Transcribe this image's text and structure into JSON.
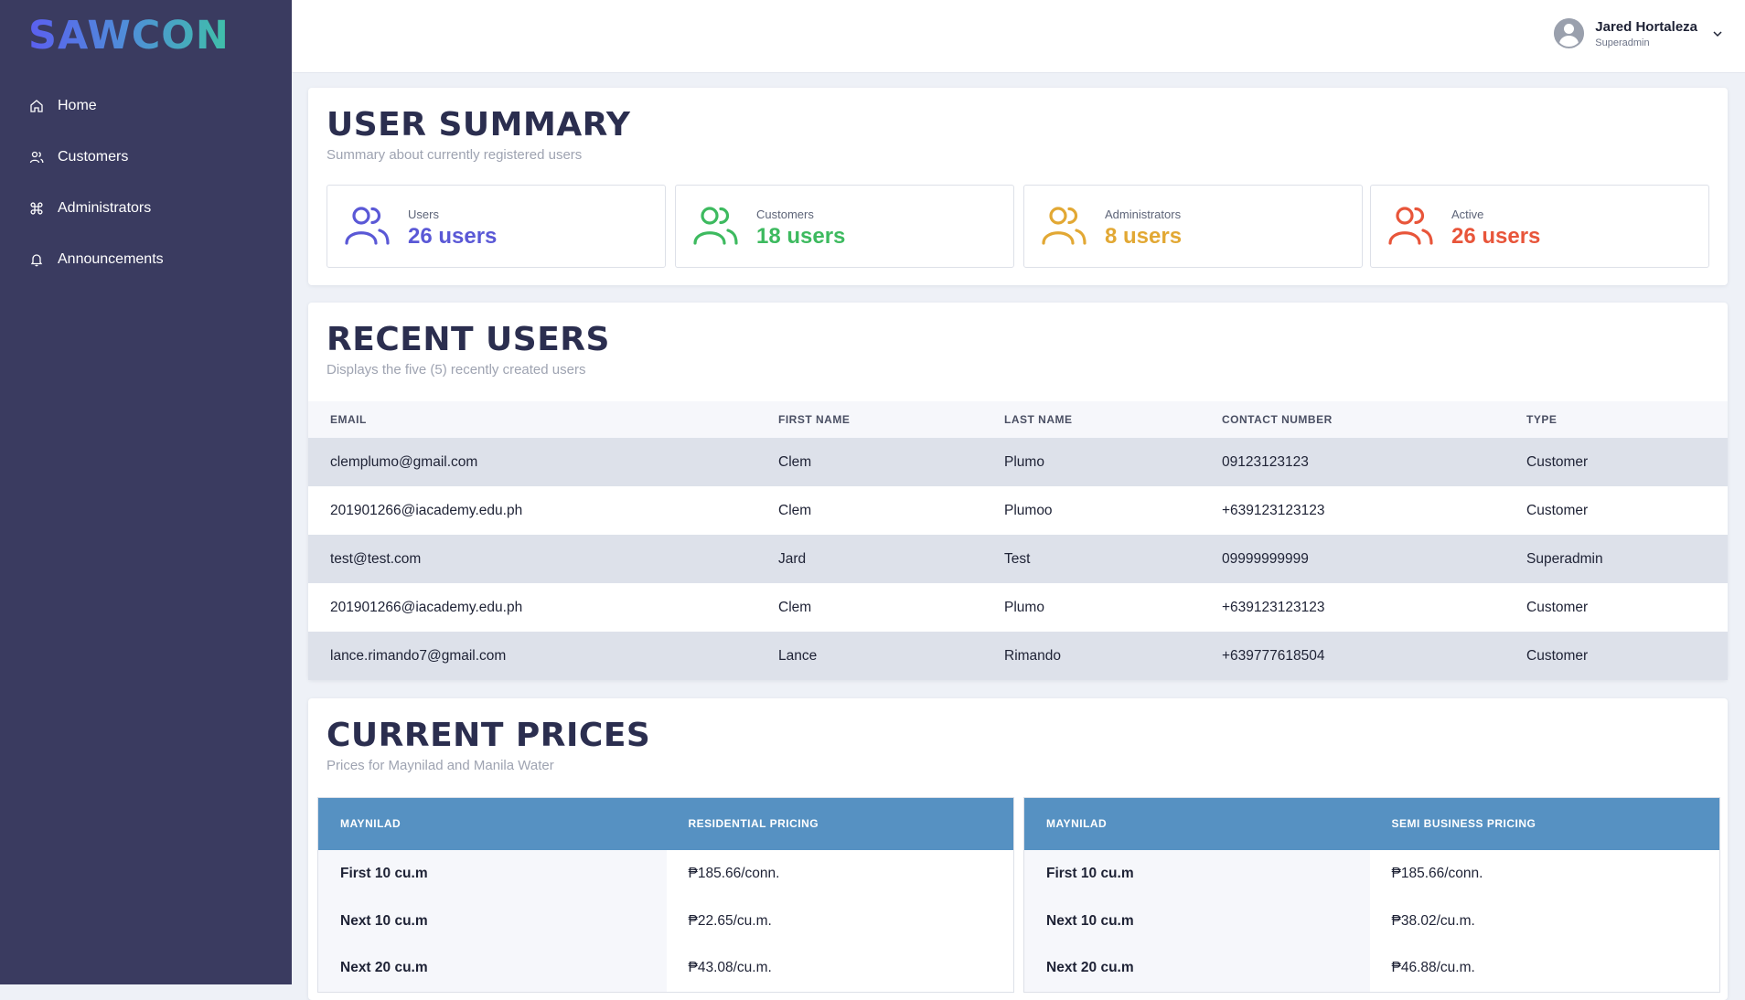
{
  "brand": "SAWCON",
  "sidebar": {
    "items": [
      {
        "label": "Home",
        "icon": "home-icon"
      },
      {
        "label": "Customers",
        "icon": "users-icon"
      },
      {
        "label": "Administrators",
        "icon": "command-icon"
      },
      {
        "label": "Announcements",
        "icon": "bell-icon"
      }
    ]
  },
  "user": {
    "name": "Jared Hortaleza",
    "role": "Superadmin"
  },
  "summary": {
    "title": "USER SUMMARY",
    "subtitle": "Summary about currently registered users",
    "stats": [
      {
        "label": "Users",
        "value": "26 users",
        "color": "#5a58d6"
      },
      {
        "label": "Customers",
        "value": "18 users",
        "color": "#3dba5f"
      },
      {
        "label": "Administrators",
        "value": "8 users",
        "color": "#e2a834"
      },
      {
        "label": "Active",
        "value": "26 users",
        "color": "#e8553a"
      }
    ]
  },
  "recent": {
    "title": "RECENT USERS",
    "subtitle": "Displays the five (5) recently created users",
    "columns": [
      "EMAIL",
      "FIRST NAME",
      "LAST NAME",
      "CONTACT NUMBER",
      "TYPE"
    ],
    "rows": [
      [
        "clemplumo@gmail.com",
        "Clem",
        "Plumo",
        "09123123123",
        "Customer"
      ],
      [
        "201901266@iacademy.edu.ph",
        "Clem",
        "Plumoo",
        "+639123123123",
        "Customer"
      ],
      [
        "test@test.com",
        "Jard",
        "Test",
        "09999999999",
        "Superadmin"
      ],
      [
        "201901266@iacademy.edu.ph",
        "Clem",
        "Plumo",
        "+639123123123",
        "Customer"
      ],
      [
        "lance.rimando7@gmail.com",
        "Lance",
        "Rimando",
        "+639777618504",
        "Customer"
      ]
    ]
  },
  "prices": {
    "title": "CURRENT PRICES",
    "subtitle": "Prices for Maynilad and Manila Water",
    "tables": [
      {
        "header": [
          "MAYNILAD",
          "RESIDENTIAL PRICING"
        ],
        "rows": [
          [
            "First 10 cu.m",
            "₱185.66/conn."
          ],
          [
            "Next 10 cu.m",
            "₱22.65/cu.m."
          ],
          [
            "Next 20 cu.m",
            "₱43.08/cu.m."
          ]
        ]
      },
      {
        "header": [
          "MAYNILAD",
          "SEMI BUSINESS PRICING"
        ],
        "rows": [
          [
            "First 10 cu.m",
            "₱185.66/conn."
          ],
          [
            "Next 10 cu.m",
            "₱38.02/cu.m."
          ],
          [
            "Next 20 cu.m",
            "₱46.88/cu.m."
          ]
        ]
      }
    ]
  }
}
